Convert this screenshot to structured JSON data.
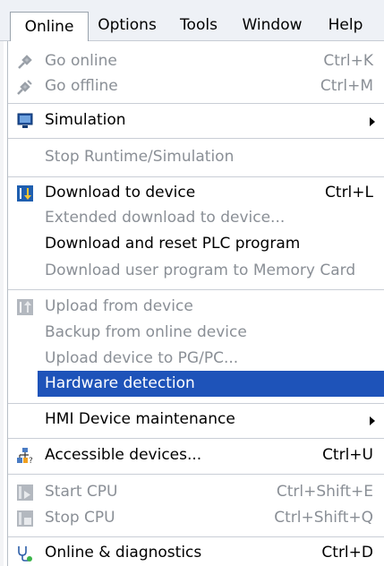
{
  "menubar": {
    "items": [
      {
        "label": "Online",
        "active": true
      },
      {
        "label": "Options"
      },
      {
        "label": "Tools"
      },
      {
        "label": "Window"
      },
      {
        "label": "Help"
      }
    ]
  },
  "menu": {
    "go_online": {
      "label": "Go online",
      "shortcut": "Ctrl+K",
      "icon": "go-online-icon",
      "enabled": false
    },
    "go_offline": {
      "label": "Go offline",
      "shortcut": "Ctrl+M",
      "icon": "go-offline-icon",
      "enabled": false
    },
    "simulation": {
      "label": "Simulation",
      "icon": "simulation-monitor-icon",
      "submenu": true
    },
    "stop_runtime": {
      "label": "Stop Runtime/Simulation",
      "enabled": false
    },
    "download_device": {
      "label": "Download to device",
      "shortcut": "Ctrl+L",
      "icon": "download-icon"
    },
    "extended_download": {
      "label": "Extended download to device...",
      "enabled": false
    },
    "download_reset": {
      "label": "Download and reset PLC program"
    },
    "download_memcard": {
      "label": "Download user program to Memory Card",
      "enabled": false
    },
    "upload_device": {
      "label": "Upload from device",
      "icon": "upload-icon",
      "enabled": false
    },
    "backup_online": {
      "label": "Backup from online device",
      "enabled": false
    },
    "upload_pgpc": {
      "label": "Upload device to PG/PC...",
      "enabled": false
    },
    "hardware_detection": {
      "label": "Hardware detection",
      "selected": true
    },
    "hmi_maintenance": {
      "label": "HMI Device maintenance",
      "submenu": true
    },
    "accessible_devices": {
      "label": "Accessible devices...",
      "shortcut": "Ctrl+U",
      "icon": "accessible-devices-icon"
    },
    "start_cpu": {
      "label": "Start CPU",
      "shortcut": "Ctrl+Shift+E",
      "icon": "start-cpu-icon",
      "enabled": false
    },
    "stop_cpu": {
      "label": "Stop CPU",
      "shortcut": "Ctrl+Shift+Q",
      "icon": "stop-cpu-icon",
      "enabled": false
    },
    "online_diag": {
      "label": "Online & diagnostics",
      "shortcut": "Ctrl+D",
      "icon": "diagnostics-icon"
    }
  },
  "colors": {
    "selection": "#1e53b9",
    "disabled_text": "#8a8f96",
    "menubar_bg": "#eef1f6"
  }
}
